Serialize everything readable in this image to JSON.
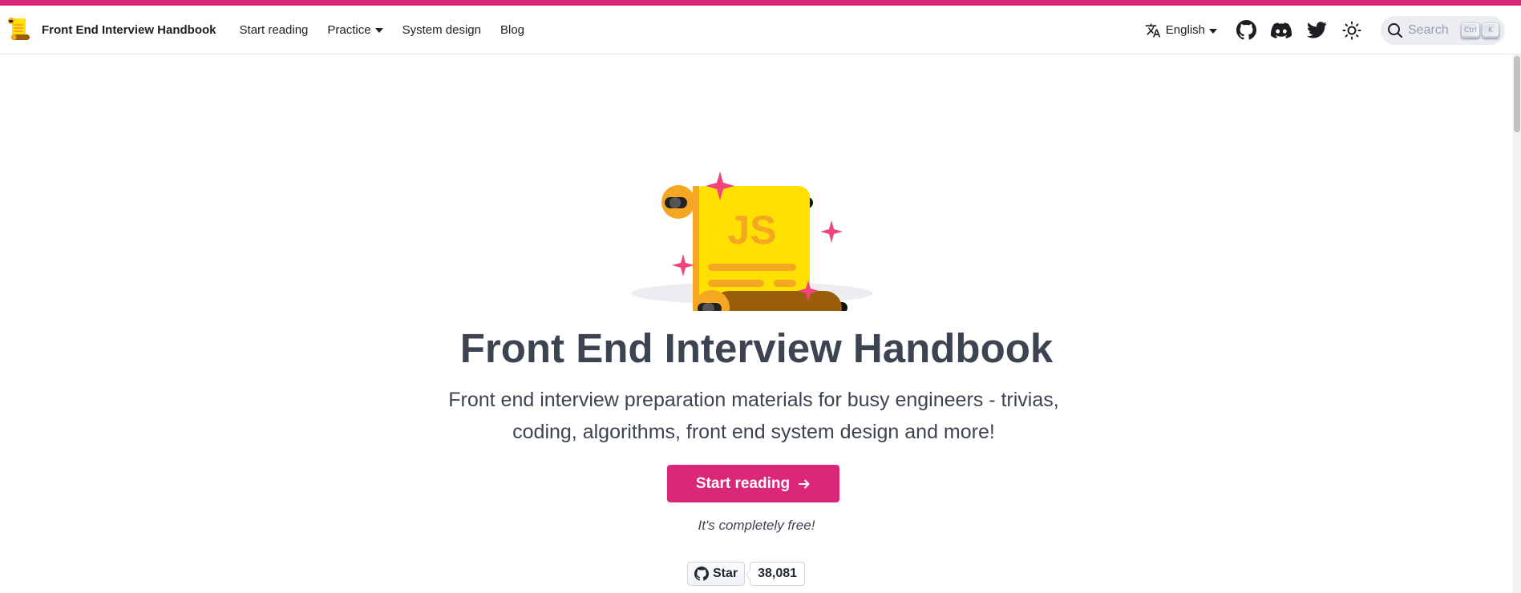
{
  "colors": {
    "accent": "#db2777",
    "heading": "#3d4451",
    "scroll_yellow": "#ffe000",
    "scroll_orange": "#f5a623",
    "scroll_brown": "#9a5e0a",
    "sparkle": "#f0447a"
  },
  "navbar": {
    "brand_title": "Front End Interview Handbook",
    "links": [
      {
        "label": "Start reading"
      },
      {
        "label": "Practice"
      },
      {
        "label": "System design"
      },
      {
        "label": "Blog"
      }
    ],
    "language": "English",
    "icons": [
      "translate-icon",
      "github-icon",
      "discord-icon",
      "twitter-icon",
      "sun-icon"
    ],
    "search": {
      "placeholder": "Search",
      "key_ctrl": "Ctrl",
      "key_k": "K"
    }
  },
  "hero": {
    "illustration_text": "JS",
    "title": "Front End Interview Handbook",
    "subtitle": "Front end interview preparation materials for busy engineers - trivias, coding, algorithms, front end system design and more!",
    "cta_label": "Start reading",
    "free_note": "It's completely free!",
    "github": {
      "star_label": "Star",
      "star_count": "38,081"
    }
  }
}
